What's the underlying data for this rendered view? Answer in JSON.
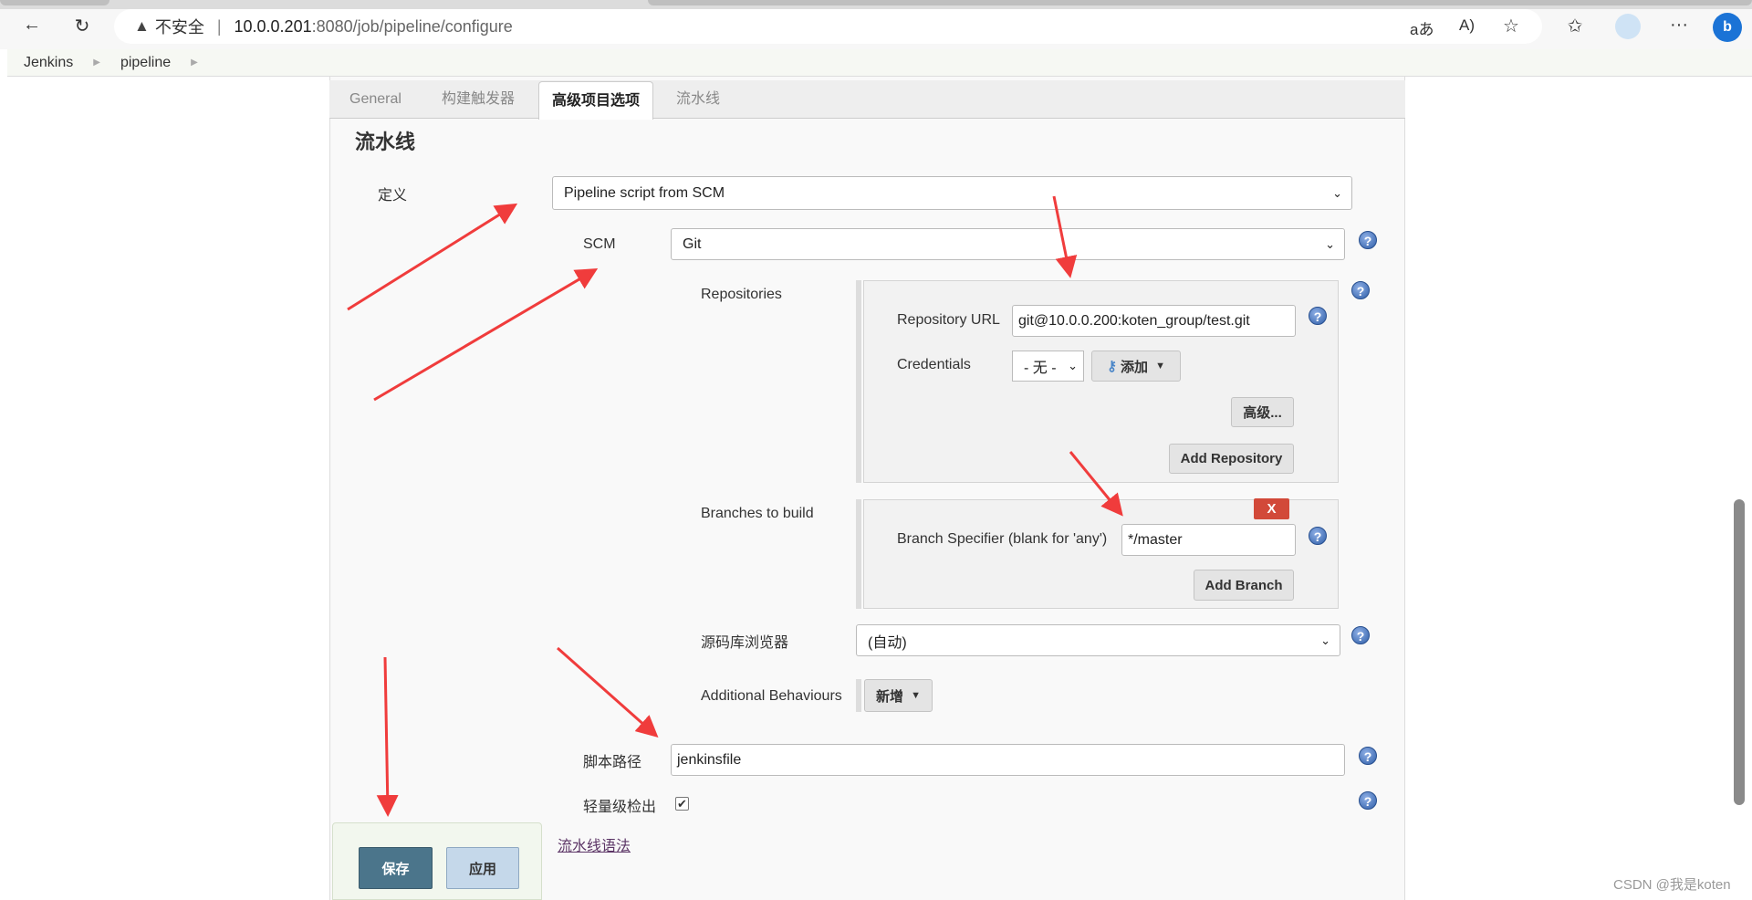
{
  "browser": {
    "security_label": "不安全",
    "url_host": "10.0.0.201",
    "url_rest": ":8080/job/pipeline/configure",
    "icons": [
      "back-icon",
      "reload-icon",
      "read-aloud-icon",
      "translate-icon",
      "favorite-star-icon",
      "favorites-icon",
      "profile-avatar",
      "more-icon",
      "bing-icon"
    ]
  },
  "breadcrumb": [
    "Jenkins",
    "pipeline"
  ],
  "tabs": [
    {
      "label": "General"
    },
    {
      "label": "构建触发器"
    },
    {
      "label": "高级项目选项",
      "active": true
    },
    {
      "label": "流水线"
    }
  ],
  "section_title": "流水线",
  "definition": {
    "label": "定义",
    "value": "Pipeline script from SCM"
  },
  "scm": {
    "label": "SCM",
    "value": "Git"
  },
  "repositories": {
    "label": "Repositories",
    "url_label": "Repository URL",
    "url_value": "git@10.0.0.200:koten_group/test.git",
    "credentials_label": "Credentials",
    "credentials_value": "- 无 -",
    "add_label": "添加",
    "advanced_label": "高级...",
    "add_repo_label": "Add Repository"
  },
  "branches": {
    "label": "Branches to build",
    "delete_label": "X",
    "specifier_label": "Branch Specifier (blank for 'any')",
    "specifier_value": "*/master",
    "add_branch_label": "Add Branch"
  },
  "browser_field": {
    "label": "源码库浏览器",
    "value": "(自动)"
  },
  "behaviours": {
    "label": "Additional Behaviours",
    "add_label": "新增"
  },
  "script_path": {
    "label": "脚本路径",
    "value": "jenkinsfile"
  },
  "lightweight": {
    "label": "轻量级检出",
    "checked": true
  },
  "syntax_link": "流水线语法",
  "actions": {
    "save": "保存",
    "apply": "应用"
  },
  "watermark": "CSDN @我是koten",
  "colors": {
    "annotation_arrow": "#f03c3c",
    "save_button": "#4b758b",
    "delete_button": "#d24939"
  }
}
